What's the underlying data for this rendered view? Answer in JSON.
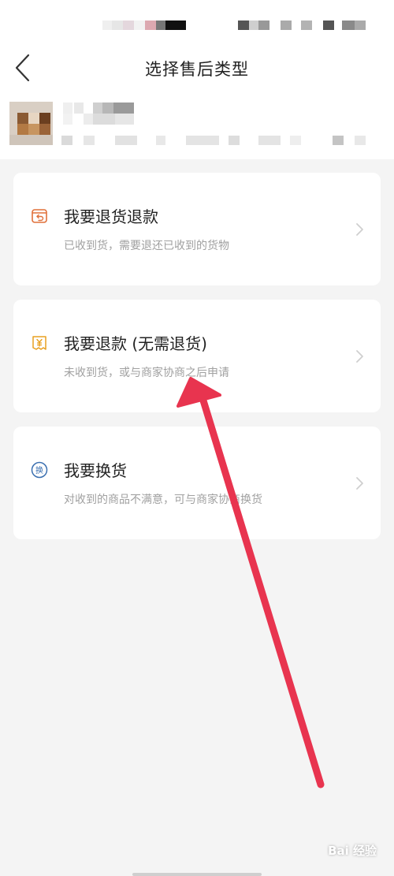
{
  "header": {
    "title": "选择售后类型"
  },
  "options": [
    {
      "title": "我要退货退款",
      "description": "已收到货，需要退还已收到的货物",
      "icon": "return-box-icon",
      "icon_color": "#e0703a"
    },
    {
      "title": "我要退款 (无需退货)",
      "description": "未收到货，或与商家协商之后申请",
      "icon": "yen-refund-icon",
      "icon_color": "#e8a020"
    },
    {
      "title": "我要换货",
      "description": "对收到的商品不满意，可与商家协商换货",
      "icon": "exchange-icon",
      "icon_color": "#3a6fb0"
    }
  ],
  "colors": {
    "annotation_arrow": "#e8344f",
    "background": "#f4f4f4",
    "card": "#ffffff"
  },
  "watermark": {
    "text": "Bai 经验"
  }
}
